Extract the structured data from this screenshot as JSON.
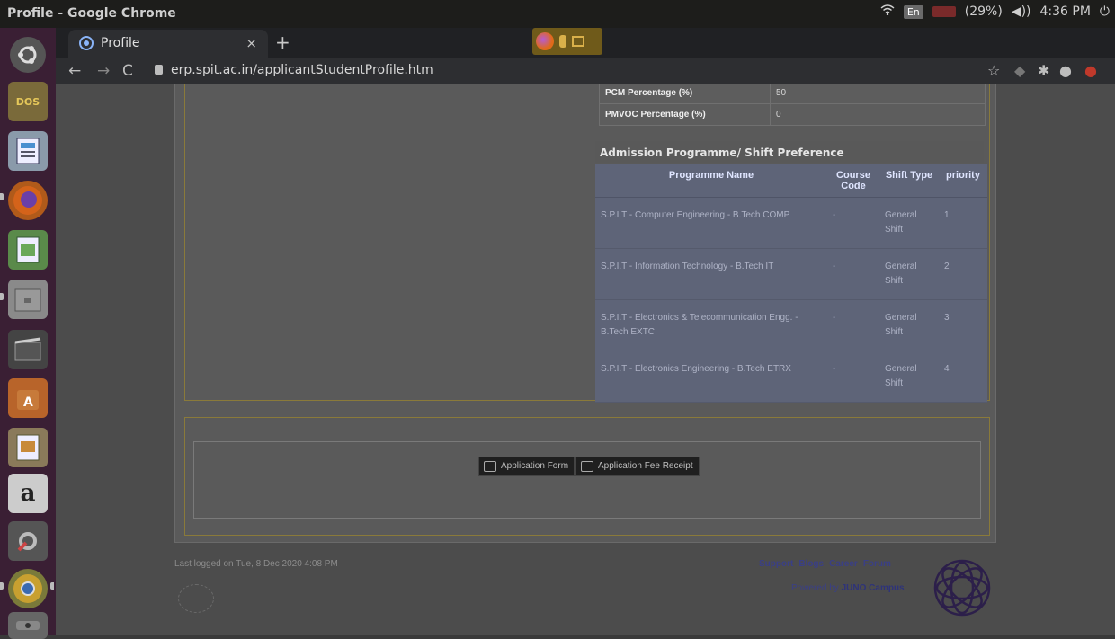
{
  "system": {
    "window_title": "Profile - Google Chrome",
    "keyboard": "En",
    "battery": "(29%)",
    "time": "4:36 PM"
  },
  "browser": {
    "tab_title": "Profile",
    "url": "erp.spit.ac.in/applicantStudentProfile.htm"
  },
  "marks": {
    "rows": [
      {
        "label": "PCM Percentage (%)",
        "value": "50"
      },
      {
        "label": "PMVOC Percentage (%)",
        "value": "0"
      }
    ]
  },
  "preference": {
    "title": "Admission Programme/ Shift Preference",
    "headers": [
      "Programme Name",
      "Course Code",
      "Shift Type",
      "priority"
    ],
    "rows": [
      {
        "programme": "S.P.I.T - Computer Engineering - B.Tech COMP",
        "code": "-",
        "shift": "General Shift",
        "priority": "1"
      },
      {
        "programme": "S.P.I.T - Information Technology - B.Tech IT",
        "code": "-",
        "shift": "General Shift",
        "priority": "2"
      },
      {
        "programme": "S.P.I.T - Electronics & Telecommunication Engg. - B.Tech EXTC",
        "code": "-",
        "shift": "General Shift",
        "priority": "3"
      },
      {
        "programme": "S.P.I.T - Electronics Engineering - B.Tech ETRX",
        "code": "-",
        "shift": "General Shift",
        "priority": "4"
      }
    ]
  },
  "actions": {
    "application_form": "Application Form",
    "fee_receipt": "Application Fee Receipt"
  },
  "footer": {
    "last_logged": "Last logged on Tue, 8 Dec 2020 4:08 PM",
    "links": [
      "Support",
      "Blogs",
      "Career",
      "Forum"
    ],
    "powered_prefix": "Powered by",
    "powered_brand": "JUNO Campus"
  },
  "colors": {
    "launcher_bg": "#3a1f34",
    "table_header_bg": "#5e6478",
    "link_color": "#3a3f86"
  }
}
